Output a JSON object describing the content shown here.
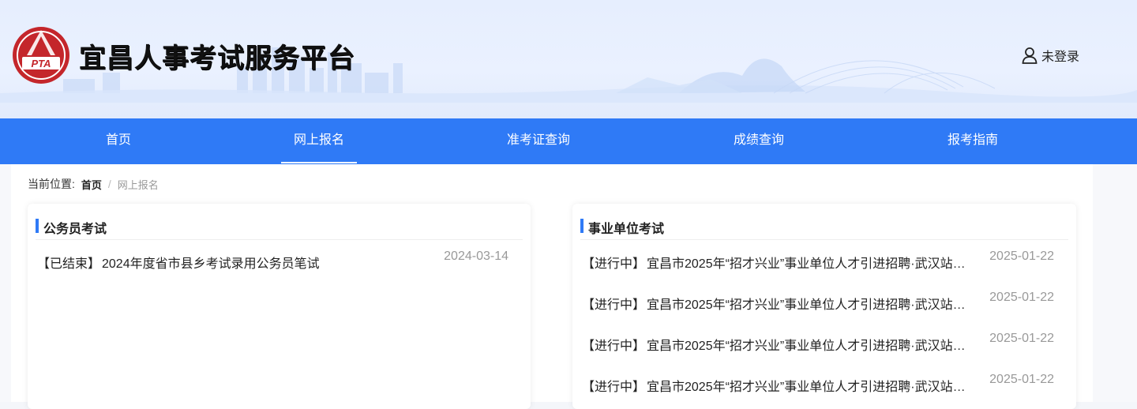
{
  "header": {
    "logo_text": "PTA",
    "site_title": "宜昌人事考试服务平台",
    "user_status": "未登录",
    "user_icon": "user-icon"
  },
  "nav": {
    "items": [
      {
        "label": "首页"
      },
      {
        "label": "网上报名"
      },
      {
        "label": "准考证查询"
      },
      {
        "label": "成绩查询"
      },
      {
        "label": "报考指南"
      }
    ],
    "active": "网上报名"
  },
  "breadcrumb": {
    "prefix": "当前位置:",
    "home": "首页",
    "separator": "/",
    "current": "网上报名"
  },
  "panels": {
    "civil": {
      "title": "公务员考试",
      "rows": [
        {
          "tag": "【已结束】",
          "title": "2024年度省市县乡考试录用公务员笔试",
          "date": "2024-03-14"
        }
      ]
    },
    "public": {
      "title": "事业单位考试",
      "rows": [
        {
          "tag": "【进行中】",
          "title": "宜昌市2025年“招才兴业”事业单位人才引进招聘·武汉站…",
          "date": "2025-01-22"
        },
        {
          "tag": "【进行中】",
          "title": "宜昌市2025年“招才兴业”事业单位人才引进招聘·武汉站…",
          "date": "2025-01-22"
        },
        {
          "tag": "【进行中】",
          "title": "宜昌市2025年“招才兴业”事业单位人才引进招聘·武汉站…",
          "date": "2025-01-22"
        },
        {
          "tag": "【进行中】",
          "title": "宜昌市2025年“招才兴业”事业单位人才引进招聘·武汉站…",
          "date": "2025-01-22"
        }
      ]
    }
  },
  "colors": {
    "nav_bg": "#2f7af6",
    "accent": "#2f7af6",
    "logo_red": "#c4262b",
    "date_gray": "#999999"
  }
}
